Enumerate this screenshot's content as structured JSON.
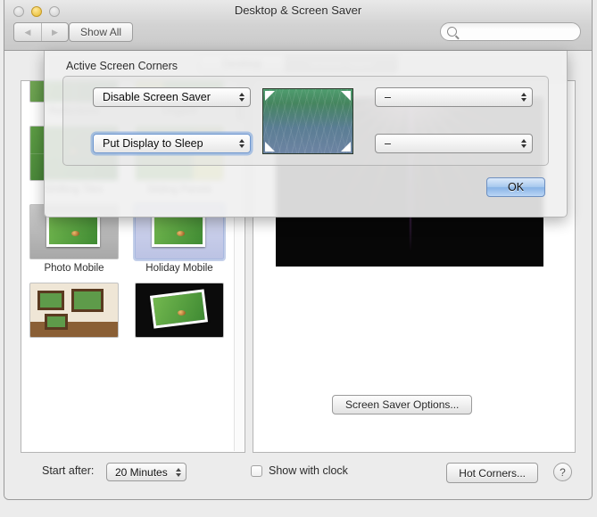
{
  "window": {
    "title": "Desktop & Screen Saver",
    "traffic_lights": [
      "close",
      "minimize",
      "zoom"
    ],
    "back_label": "◀",
    "forward_label": "▶",
    "show_all_label": "Show All",
    "search_placeholder": "",
    "search_value": "",
    "search_icon": "search-icon"
  },
  "tabs": [
    {
      "label": "Desktop",
      "active": false
    },
    {
      "label": "Screen Saver",
      "active": true
    }
  ],
  "screensavers": {
    "items": [
      {
        "label": "Reflections",
        "art": "art-reflect",
        "selected": false
      },
      {
        "label": "Origami",
        "art": "art-origami",
        "selected": false
      },
      {
        "label": "Shifting Tiles",
        "art": "art-tiles",
        "selected": false
      },
      {
        "label": "Sliding Panels",
        "art": "art-panels",
        "selected": false
      },
      {
        "label": "Photo Mobile",
        "art": "art-photomob",
        "selected": false
      },
      {
        "label": "Holiday Mobile",
        "art": "art-holiday",
        "selected": true
      },
      {
        "label": "",
        "art": "art-wall",
        "selected": false
      },
      {
        "label": "",
        "art": "art-shuffle",
        "selected": false
      }
    ]
  },
  "preview": {
    "screen_saver_options_label": "Screen Saver Options..."
  },
  "bottom_bar": {
    "start_after_label": "Start after:",
    "start_after_value": "20 Minutes",
    "show_with_clock_label": "Show with clock",
    "show_with_clock_checked": false,
    "hot_corners_label": "Hot Corners...",
    "help_label": "?"
  },
  "sheet": {
    "title": "Active Screen Corners",
    "corners": {
      "top_left": "Disable Screen Saver",
      "bottom_left": "Put Display to Sleep",
      "top_right": "–",
      "bottom_right": "–"
    },
    "focused_corner": "bottom_left",
    "ok_label": "OK"
  },
  "colors": {
    "accent": "#88b3e6",
    "focus_ring": "#6d96cf",
    "window_bg": "#ececec",
    "minimize_light": "#e5b92c"
  }
}
